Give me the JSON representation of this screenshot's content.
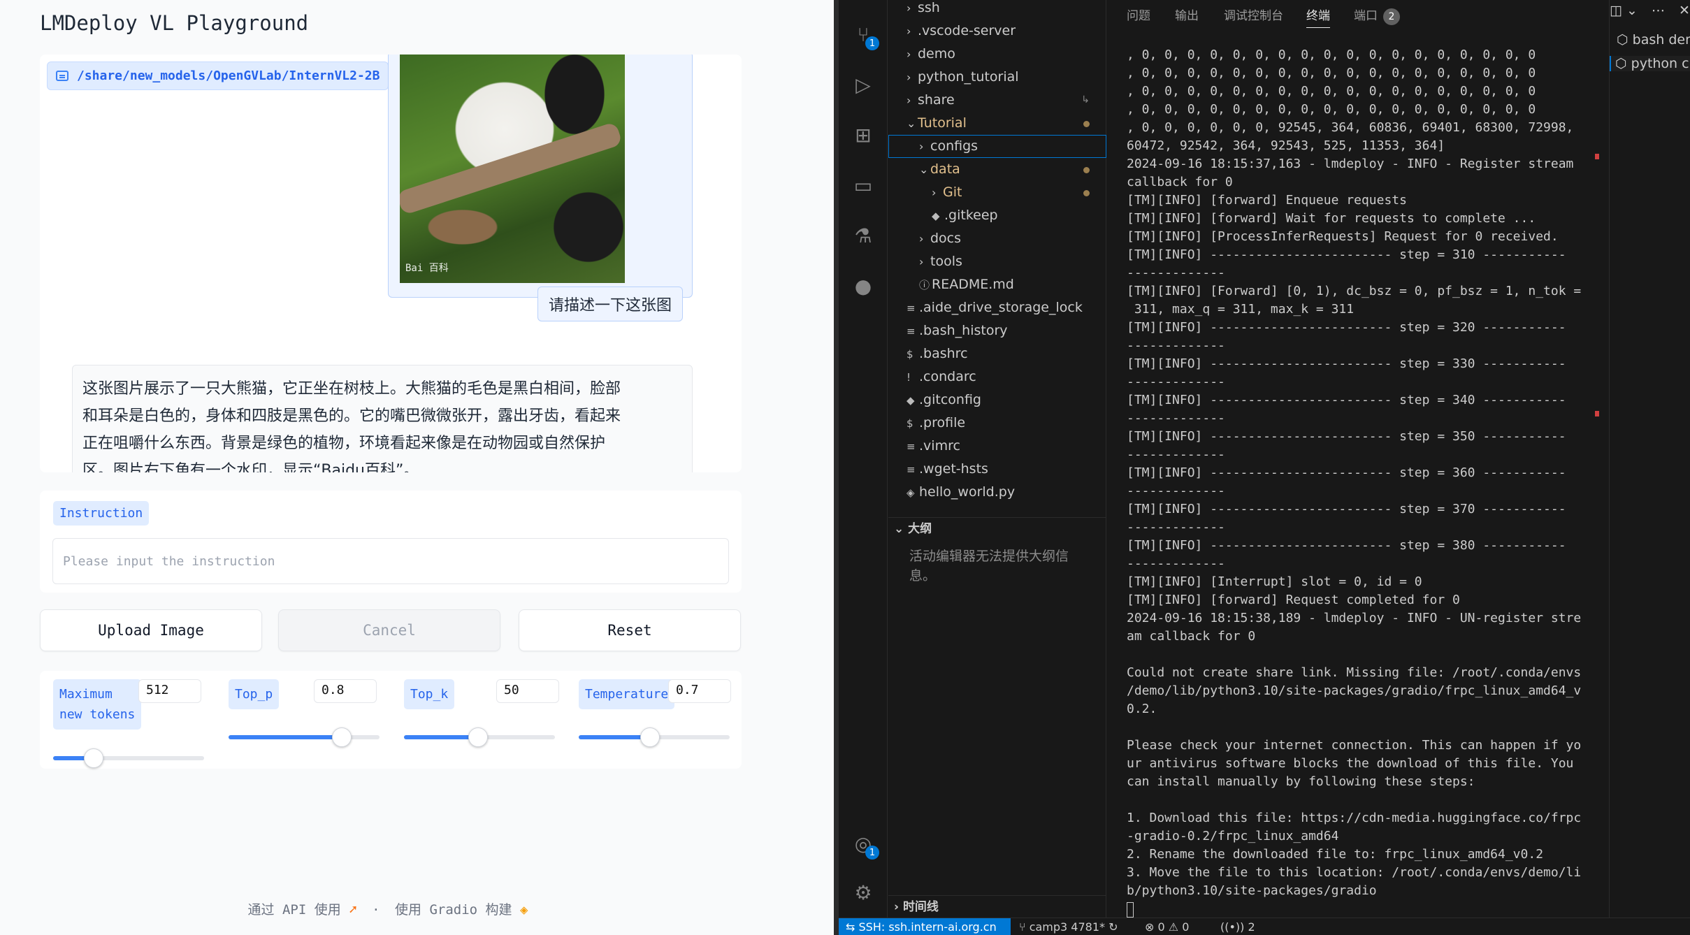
{
  "gradio": {
    "title": "LMDeploy VL Playground",
    "model_path": "/share/new_models/OpenGVLab/InternVL2-2B",
    "image_watermark": "Bai 百科",
    "user_text": "请描述一下这张图",
    "bot_reply": [
      "这张图片展示了一只大熊猫，它正坐在树枝上。大熊猫的毛色是黑白相间，脸部",
      "和耳朵是白色的，身体和四肢是黑色的。它的嘴巴微微张开，露出牙齿，看起来",
      "正在咀嚼什么东西。背景是绿色的植物，环境看起来像是在动物园或自然保护",
      "区。图片右下角有一个水印，显示“Baidu百科”。"
    ],
    "instruction_label": "Instruction",
    "instruction_placeholder": "Please input the instruction",
    "buttons": {
      "upload": "Upload Image",
      "cancel": "Cancel",
      "reset": "Reset"
    },
    "params": {
      "max_tokens": {
        "label": [
          "Maximum",
          "new tokens"
        ],
        "value": "512",
        "fraction": 0.27
      },
      "top_p": {
        "label": "Top_p",
        "value": "0.8",
        "fraction": 0.75
      },
      "top_k": {
        "label": "Top_k",
        "value": "50",
        "fraction": 0.49
      },
      "temperature": {
        "label": "Temperature",
        "value": "0.7",
        "fraction": 0.47
      }
    },
    "footer": {
      "api": "通过 API 使用",
      "sep": "·",
      "built": "使用 Gradio 构建"
    }
  },
  "vscode": {
    "explorer": [
      {
        "label": "ssh",
        "kind": "folder",
        "depth": 1,
        "open": false
      },
      {
        "label": ".vscode-server",
        "kind": "folder",
        "depth": 1,
        "open": false
      },
      {
        "label": "demo",
        "kind": "folder",
        "depth": 1,
        "open": false
      },
      {
        "label": "python_tutorial",
        "kind": "folder",
        "depth": 1,
        "open": false
      },
      {
        "label": "share",
        "kind": "folder",
        "depth": 1,
        "open": false,
        "symlink": "↳"
      },
      {
        "label": "Tutorial",
        "kind": "folder",
        "depth": 1,
        "open": true,
        "modified": true
      },
      {
        "label": "configs",
        "kind": "folder",
        "depth": 2,
        "open": false,
        "selected": true
      },
      {
        "label": "data",
        "kind": "folder",
        "depth": 2,
        "open": true,
        "modified": true
      },
      {
        "label": "Git",
        "kind": "folder",
        "depth": 3,
        "open": false,
        "modified": true
      },
      {
        "label": ".gitkeep",
        "kind": "file",
        "depth": 3,
        "icon": "◆"
      },
      {
        "label": "docs",
        "kind": "folder",
        "depth": 2,
        "open": false
      },
      {
        "label": "tools",
        "kind": "folder",
        "depth": 2,
        "open": false
      },
      {
        "label": "README.md",
        "kind": "file",
        "depth": 2,
        "icon": "ⓘ"
      },
      {
        "label": ".aide_drive_storage_lock",
        "kind": "file",
        "depth": 1,
        "icon": "≡"
      },
      {
        "label": ".bash_history",
        "kind": "file",
        "depth": 1,
        "icon": "≡"
      },
      {
        "label": ".bashrc",
        "kind": "file",
        "depth": 1,
        "icon": "$"
      },
      {
        "label": ".condarc",
        "kind": "file",
        "depth": 1,
        "icon": "!"
      },
      {
        "label": ".gitconfig",
        "kind": "file",
        "depth": 1,
        "icon": "◆"
      },
      {
        "label": ".profile",
        "kind": "file",
        "depth": 1,
        "icon": "$"
      },
      {
        "label": ".vimrc",
        "kind": "file",
        "depth": 1,
        "icon": "≡"
      },
      {
        "label": ".wget-hsts",
        "kind": "file",
        "depth": 1,
        "icon": "≡"
      },
      {
        "label": "hello_world.py",
        "kind": "file",
        "depth": 1,
        "icon": "◈"
      }
    ],
    "outline_title": "大纲",
    "outline_msg": "活动编辑器无法提供大纲信息。",
    "timeline_title": "时间线",
    "panel_tabs": [
      "问题",
      "输出",
      "调试控制台",
      "终端",
      "端口"
    ],
    "ports_count": "2",
    "terminal_lines": [
      ", 0, 0, 0, 0, 0, 0, 0, 0, 0, 0, 0, 0, 0, 0, 0, 0, 0, 0",
      ", 0, 0, 0, 0, 0, 0, 0, 0, 0, 0, 0, 0, 0, 0, 0, 0, 0, 0",
      ", 0, 0, 0, 0, 0, 0, 0, 0, 0, 0, 0, 0, 0, 0, 0, 0, 0, 0",
      ", 0, 0, 0, 0, 0, 0, 0, 0, 0, 0, 0, 0, 0, 0, 0, 0, 0, 0",
      ", 0, 0, 0, 0, 0, 0, 92545, 364, 60836, 69401, 68300, 72998,",
      "60472, 92542, 364, 92543, 525, 11353, 364]",
      "2024-09-16 18:15:37,163 - lmdeploy - INFO - Register stream",
      "callback for 0",
      "[TM][INFO] [forward] Enqueue requests",
      "[TM][INFO] [forward] Wait for requests to complete ...",
      "[TM][INFO] [ProcessInferRequests] Request for 0 received.",
      "[TM][INFO] ------------------------ step = 310 -----------",
      "-------------",
      "[TM][INFO] [Forward] [0, 1), dc_bsz = 0, pf_bsz = 1, n_tok =",
      " 311, max_q = 311, max_k = 311",
      "[TM][INFO] ------------------------ step = 320 -----------",
      "-------------",
      "[TM][INFO] ------------------------ step = 330 -----------",
      "-------------",
      "[TM][INFO] ------------------------ step = 340 -----------",
      "-------------",
      "[TM][INFO] ------------------------ step = 350 -----------",
      "-------------",
      "[TM][INFO] ------------------------ step = 360 -----------",
      "-------------",
      "[TM][INFO] ------------------------ step = 370 -----------",
      "-------------",
      "[TM][INFO] ------------------------ step = 380 -----------",
      "-------------",
      "[TM][INFO] [Interrupt] slot = 0, id = 0",
      "[TM][INFO] [forward] Request completed for 0",
      "2024-09-16 18:15:38,189 - lmdeploy - INFO - UN-register stre",
      "am callback for 0",
      "",
      "Could not create share link. Missing file: /root/.conda/envs",
      "/demo/lib/python3.10/site-packages/gradio/frpc_linux_amd64_v",
      "0.2.",
      "",
      "Please check your internet connection. This can happen if yo",
      "ur antivirus software blocks the download of this file. You",
      "can install manually by following these steps:",
      "",
      "1. Download this file: https://cdn-media.huggingface.co/frpc",
      "-gradio-0.2/frpc_linux_amd64",
      "2. Rename the downloaded file to: frpc_linux_amd64_v0.2",
      "3. Move the file to this location: /root/.conda/envs/demo/li",
      "b/python3.10/site-packages/gradio"
    ],
    "side_tabs": [
      "bash dem",
      "python c"
    ],
    "status": {
      "remote": "SSH: ssh.intern-ai.org.cn",
      "branch": "camp3 4781*",
      "problems": "⊗ 0 ⚠ 0",
      "ports": "2"
    }
  }
}
